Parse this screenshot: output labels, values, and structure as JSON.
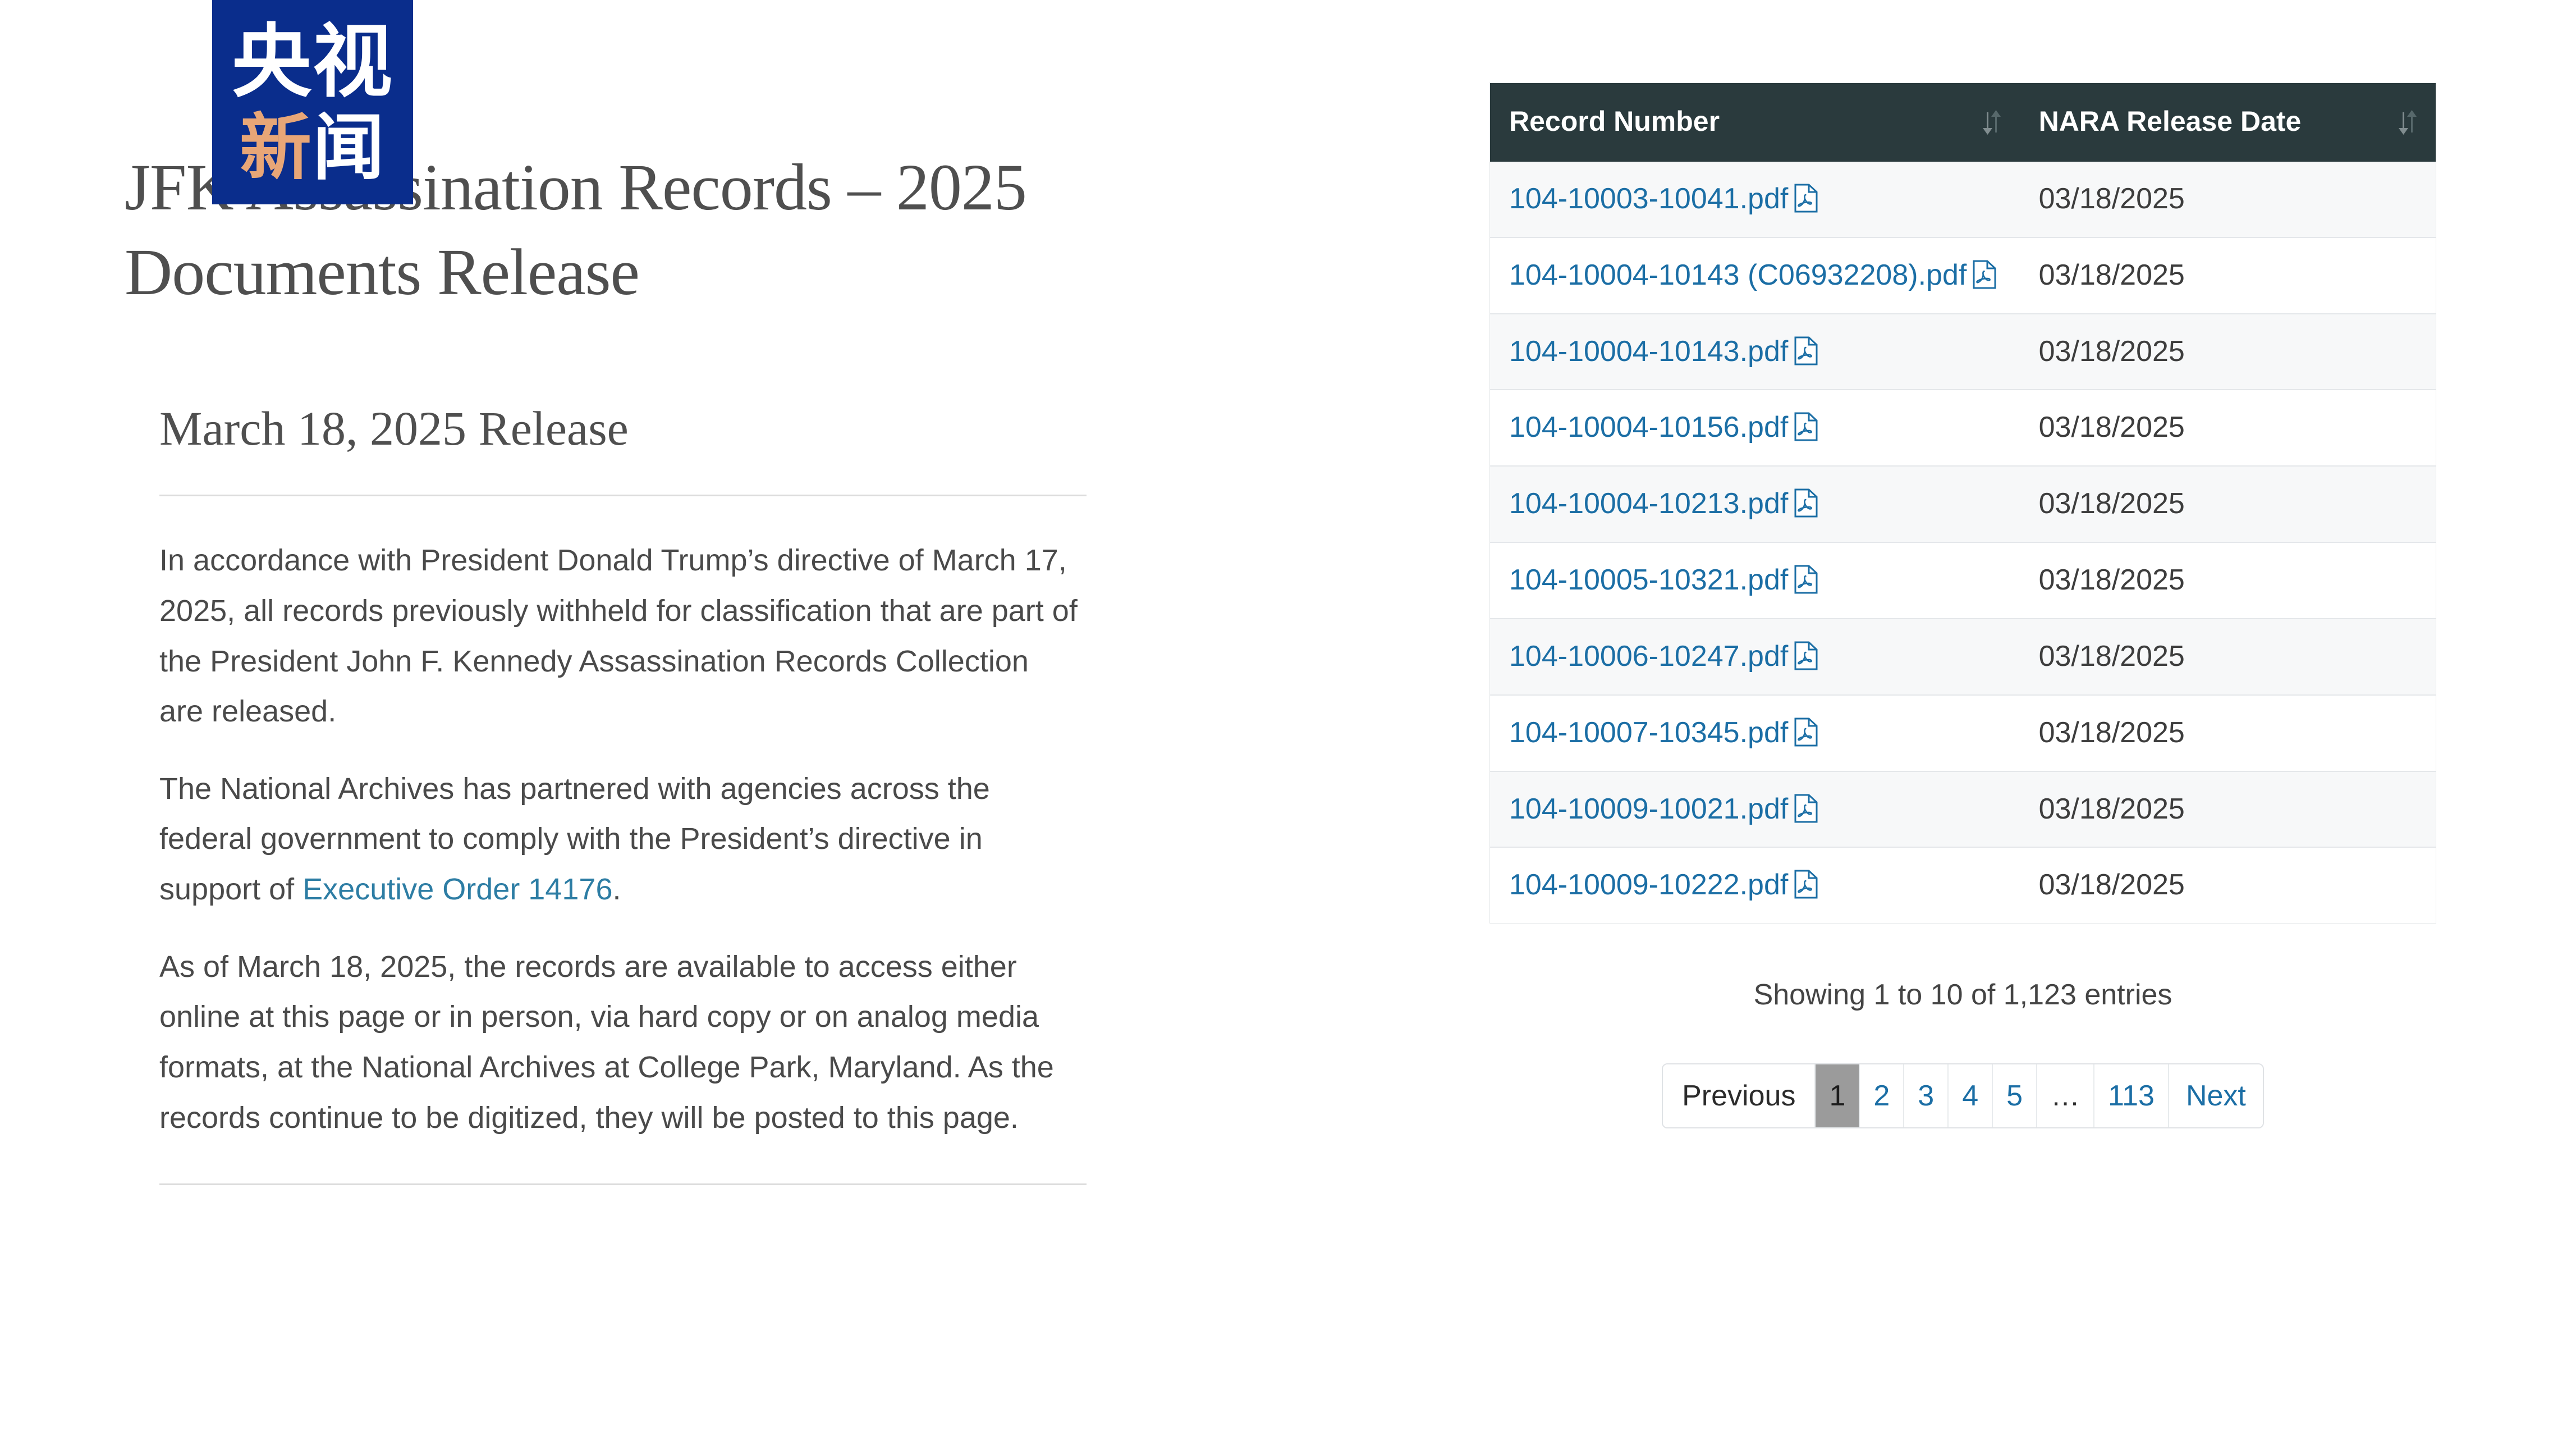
{
  "logo": {
    "line1": "央视",
    "line2_orange": "新",
    "line2_white": "闻",
    "blue": "#0a2d8c",
    "orange": "#e8a677"
  },
  "article": {
    "title": "JFK Assassination Records – 2025 Documents Release",
    "release_heading": "March 18, 2025 Release",
    "paragraph_1": "In accordance with President Donald Trump’s directive of March 17, 2025, all records previously withheld for classification that are part of the President John F. Kennedy Assassination Records Collection are released.",
    "paragraph_2_before_link": "The National Archives has partnered with agencies across the federal government to comply with the President’s directive in support of ",
    "paragraph_2_link": "Executive Order 14176",
    "paragraph_2_after_link": ".",
    "paragraph_3": "As of March 18, 2025, the records are available to access either online at this page or in person, via hard copy or on analog media formats, at the National Archives at College Park, Maryland. As the records continue to be digitized, they will be posted to this page.",
    "link_color": "#2d7da4"
  },
  "table": {
    "header_bg": "#2a3a3d",
    "link_color": "#1b6ea5",
    "columns": [
      {
        "label": "Record Number",
        "sort_icon": "sort-both-icon"
      },
      {
        "label": "NARA Release Date",
        "sort_icon": "sort-both-icon"
      }
    ],
    "rows": [
      {
        "record": "104-10003-10041.pdf",
        "file_icon": "pdf-file-icon",
        "date": "03/18/2025"
      },
      {
        "record": "104-10004-10143 (C06932208).pdf",
        "file_icon": "pdf-file-icon",
        "date": "03/18/2025"
      },
      {
        "record": "104-10004-10143.pdf",
        "file_icon": "pdf-file-icon",
        "date": "03/18/2025"
      },
      {
        "record": "104-10004-10156.pdf",
        "file_icon": "pdf-file-icon",
        "date": "03/18/2025"
      },
      {
        "record": "104-10004-10213.pdf",
        "file_icon": "pdf-file-icon",
        "date": "03/18/2025"
      },
      {
        "record": "104-10005-10321.pdf",
        "file_icon": "pdf-file-icon",
        "date": "03/18/2025"
      },
      {
        "record": "104-10006-10247.pdf",
        "file_icon": "pdf-file-icon",
        "date": "03/18/2025"
      },
      {
        "record": "104-10007-10345.pdf",
        "file_icon": "pdf-file-icon",
        "date": "03/18/2025"
      },
      {
        "record": "104-10009-10021.pdf",
        "file_icon": "pdf-file-icon",
        "date": "03/18/2025"
      },
      {
        "record": "104-10009-10222.pdf",
        "file_icon": "pdf-file-icon",
        "date": "03/18/2025"
      }
    ]
  },
  "footer": {
    "showing_entries": "Showing 1 to 10 of 1,123 entries"
  },
  "pagination": {
    "previous": "Previous",
    "pages": [
      "1",
      "2",
      "3",
      "4",
      "5"
    ],
    "ellipsis": "…",
    "last_page": "113",
    "next": "Next",
    "active_page": "1"
  }
}
